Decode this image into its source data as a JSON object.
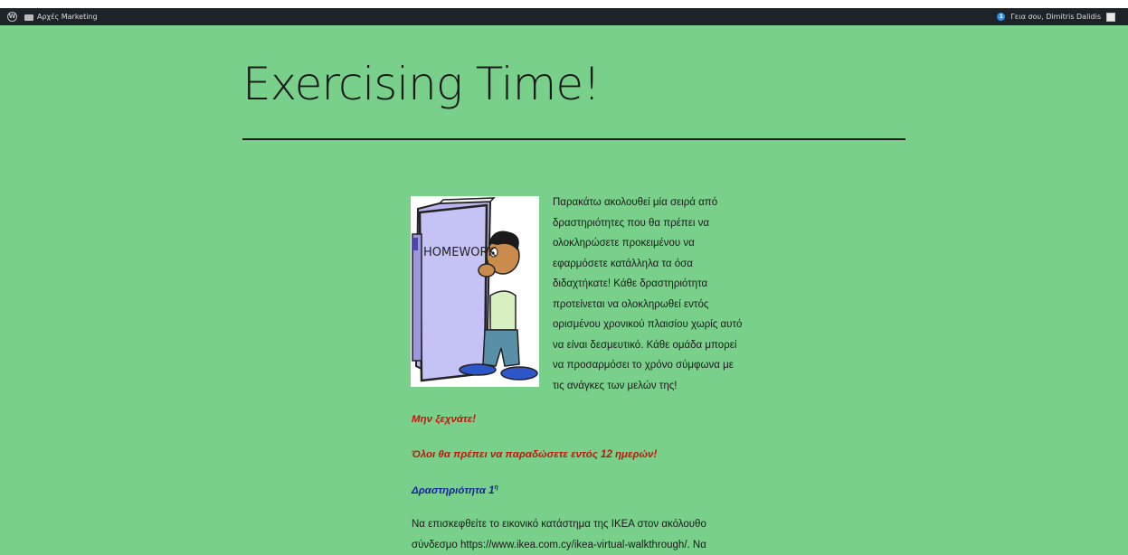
{
  "adminbar": {
    "site_name": "Αρχές Marketing",
    "greeting": "Γεια σου, Dimitris Dalidis",
    "notifications_count": "1"
  },
  "page": {
    "title": "Exercising Time!"
  },
  "content": {
    "image_label": "HOMEWORK",
    "intro": "Παρακάτω ακολουθεί μία σειρά από δραστηριότητες που θα πρέπει να ολοκληρώσετε προκειμένου να εφαρμόσετε κατάλληλα τα όσα διδαχτήκατε! Κάθε δραστηριότητα προτείνεται να ολοκληρωθεί εντός ορισμένου χρονικού πλαισίου χωρίς αυτό να είναι δεσμευτικό. Κάθε ομάδα μπορεί να προσαρμόσει το χρόνο σύμφωνα με τις ανάγκες των μελών της!",
    "reminder": "Μην ξεχνάτε!",
    "deadline": "Όλοι θα πρέπει να παραδώσετε εντός 12 ημερών!",
    "activity_heading": "Δραστηριότητα 1",
    "activity_heading_sup": "η",
    "activity_text": "Να επισκεφθείτε το εικονικό κατάστημα της ΙΚΕΑ στον ακόλουθο σύνδεσμο https://www.ikea.com.cy/ikea-virtual-walkthrough/. Να"
  },
  "colors": {
    "background": "#78d08a",
    "adminbar": "#1d2327",
    "reminder_red": "#c0160e",
    "heading_blue": "#16239a"
  },
  "icons": [
    "wordpress-logo-icon",
    "site-home-icon",
    "notification-icon",
    "avatar-icon"
  ]
}
